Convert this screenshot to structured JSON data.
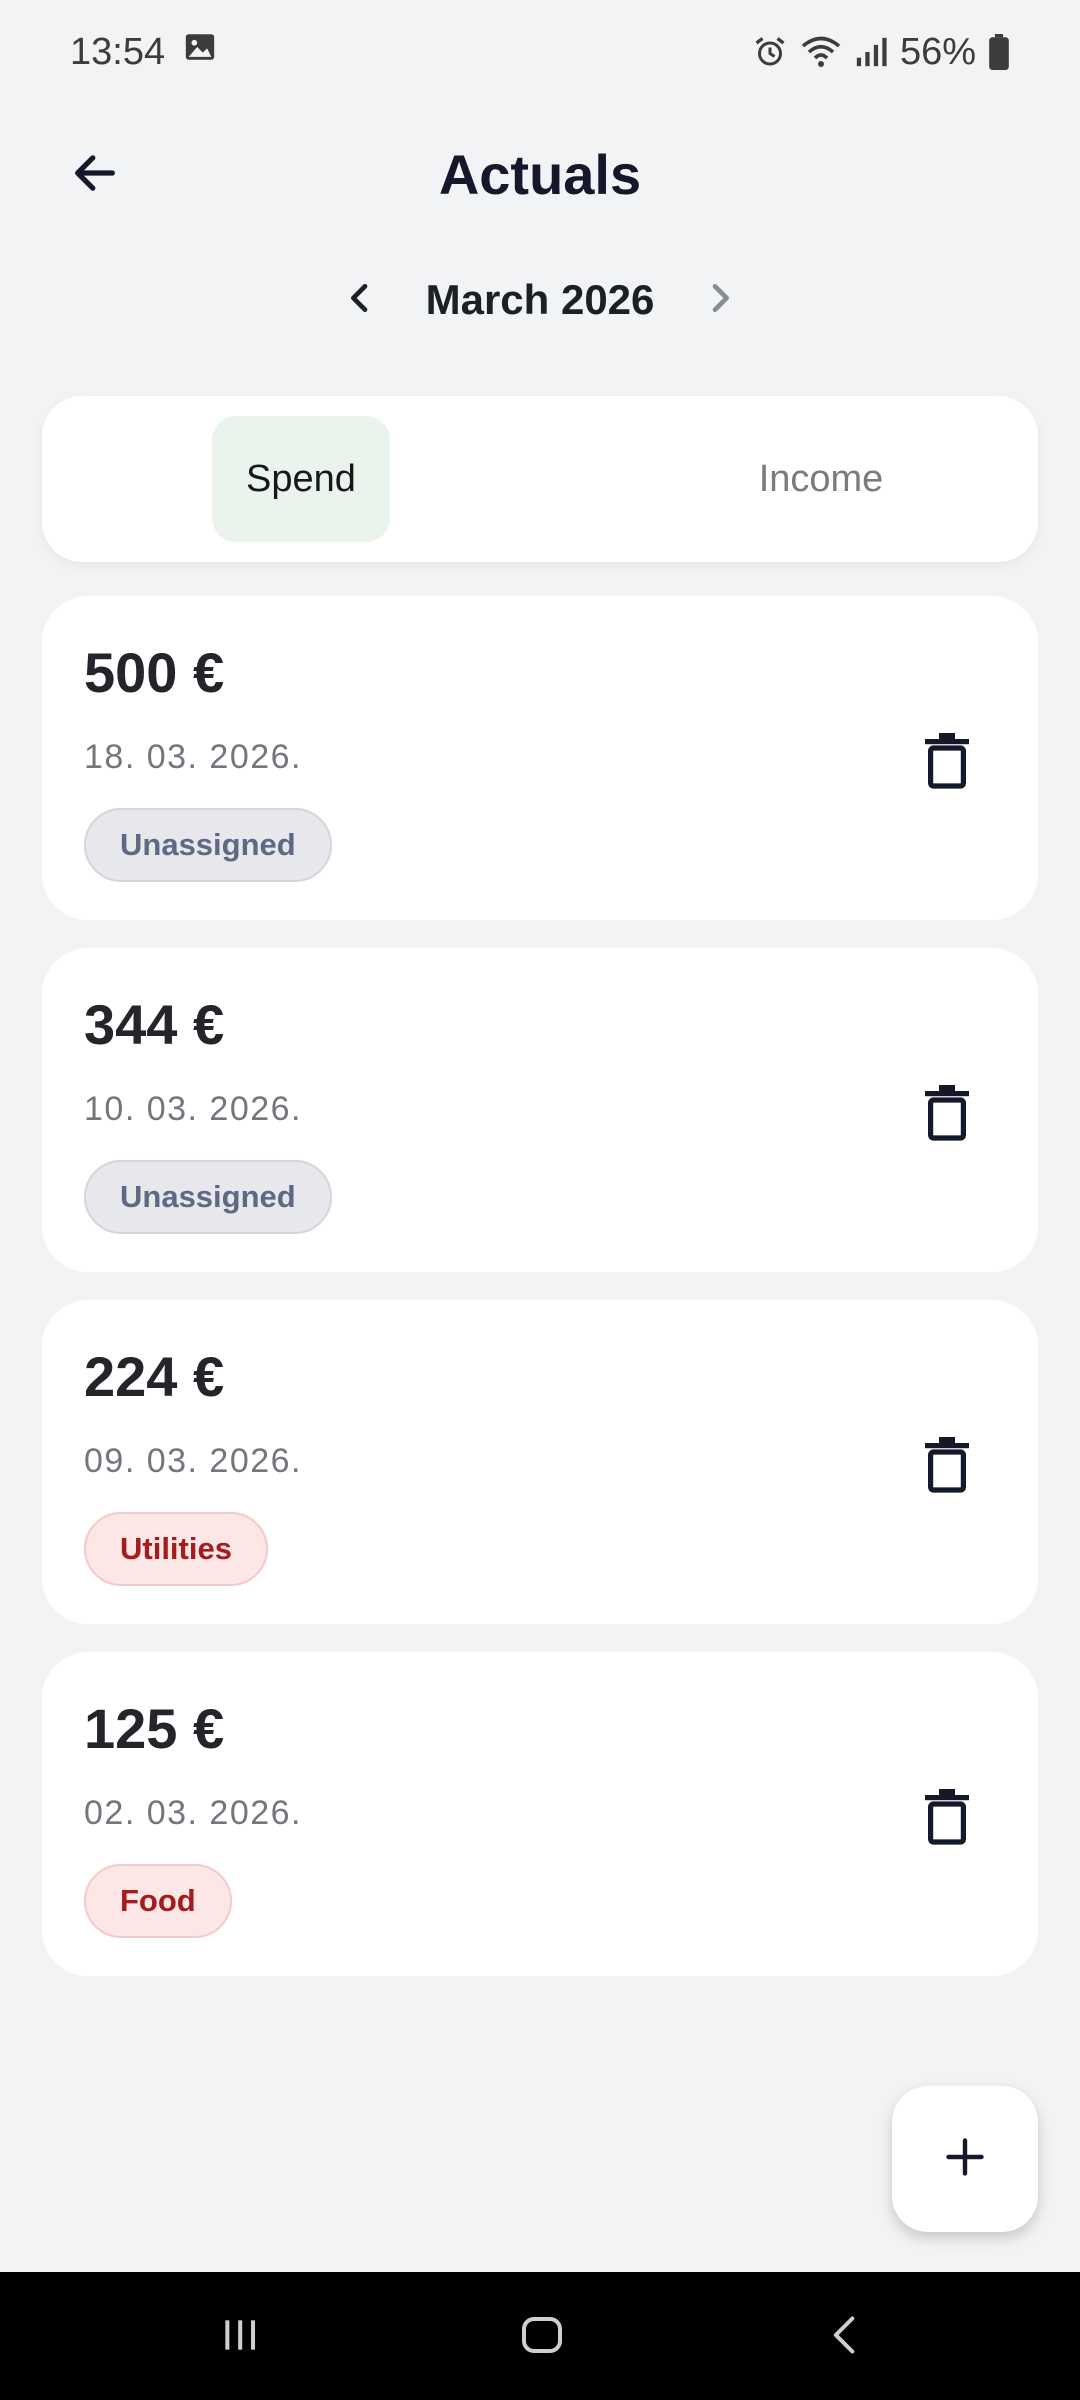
{
  "status_bar": {
    "time": "13:54",
    "battery": "56%",
    "icons": [
      "gallery-icon",
      "alarm-icon",
      "wifi-icon",
      "signal-icon",
      "battery-icon"
    ]
  },
  "header": {
    "title": "Actuals",
    "back_icon": "arrow-left-icon"
  },
  "month_nav": {
    "label": "March 2026",
    "prev_icon": "chevron-left-icon",
    "next_icon": "chevron-right-icon"
  },
  "tabs": {
    "spend": "Spend",
    "income": "Income",
    "active": "spend",
    "active_color": "#eaf4ec"
  },
  "transactions": [
    {
      "amount": "500 €",
      "date": "18. 03. 2026.",
      "category": "Unassigned",
      "category_style": "neutral"
    },
    {
      "amount": "344 €",
      "date": "10. 03. 2026.",
      "category": "Unassigned",
      "category_style": "neutral"
    },
    {
      "amount": "224 €",
      "date": "09. 03. 2026.",
      "category": "Utilities",
      "category_style": "red"
    },
    {
      "amount": "125 €",
      "date": "02. 03. 2026.",
      "category": "Food",
      "category_style": "red"
    }
  ],
  "fab": {
    "icon": "plus-icon"
  },
  "colors": {
    "background": "#f2f3f5",
    "card": "#ffffff",
    "badge_neutral_text": "#5e6a85",
    "badge_red_text": "#a61b1b",
    "badge_red_bg": "#fde6e6"
  }
}
